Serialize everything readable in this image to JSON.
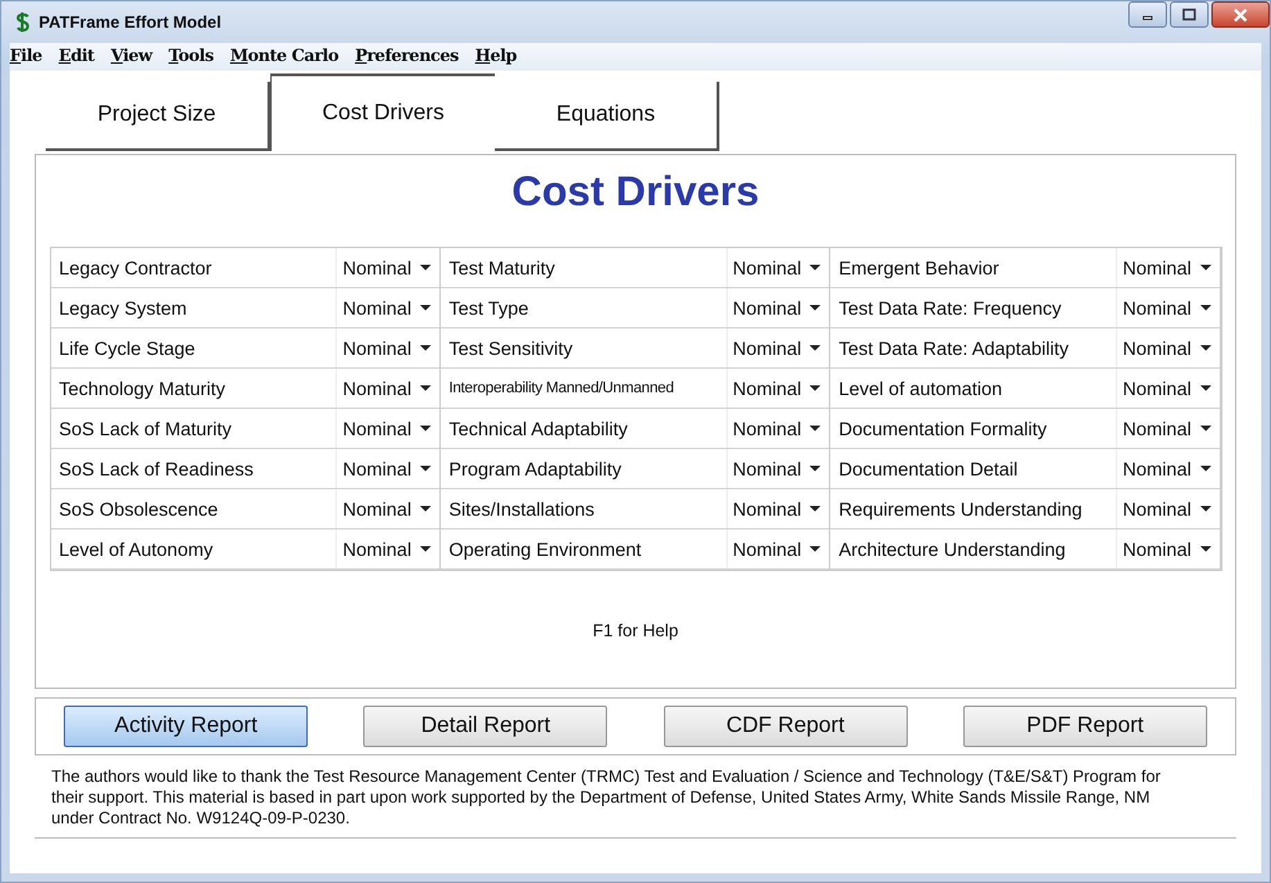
{
  "window": {
    "title": "PATFrame Effort Model"
  },
  "menu": [
    "File",
    "Edit",
    "View",
    "Tools",
    "Monte Carlo",
    "Preferences",
    "Help"
  ],
  "tabs": [
    {
      "label": "Project Size",
      "selected": false
    },
    {
      "label": "Cost Drivers",
      "selected": true
    },
    {
      "label": "Equations",
      "selected": false
    }
  ],
  "panel": {
    "heading": "Cost Drivers",
    "help": "F1 for Help"
  },
  "drivers": [
    [
      {
        "name": "Legacy Contractor",
        "value": "Nominal"
      },
      {
        "name": "Legacy System",
        "value": "Nominal"
      },
      {
        "name": "Life Cycle Stage",
        "value": "Nominal"
      },
      {
        "name": "Technology Maturity",
        "value": "Nominal"
      },
      {
        "name": "SoS Lack of Maturity",
        "value": "Nominal"
      },
      {
        "name": "SoS Lack of Readiness",
        "value": "Nominal"
      },
      {
        "name": "SoS Obsolescence",
        "value": "Nominal"
      },
      {
        "name": "Level of Autonomy",
        "value": "Nominal"
      }
    ],
    [
      {
        "name": "Test Maturity",
        "value": "Nominal"
      },
      {
        "name": "Test Type",
        "value": "Nominal"
      },
      {
        "name": "Test Sensitivity",
        "value": "Nominal"
      },
      {
        "name": "Interoperability Manned/Unmanned",
        "value": "Nominal"
      },
      {
        "name": "Technical Adaptability",
        "value": "Nominal"
      },
      {
        "name": "Program Adaptability",
        "value": "Nominal"
      },
      {
        "name": "Sites/Installations",
        "value": "Nominal"
      },
      {
        "name": "Operating Environment",
        "value": "Nominal"
      }
    ],
    [
      {
        "name": "Emergent Behavior",
        "value": "Nominal"
      },
      {
        "name": "Test Data Rate: Frequency",
        "value": "Nominal"
      },
      {
        "name": "Test Data Rate: Adaptability",
        "value": "Nominal"
      },
      {
        "name": "Level of automation",
        "value": "Nominal"
      },
      {
        "name": "Documentation Formality",
        "value": "Nominal"
      },
      {
        "name": "Documentation Detail",
        "value": "Nominal"
      },
      {
        "name": "Requirements Understanding",
        "value": "Nominal"
      },
      {
        "name": "Architecture Understanding",
        "value": "Nominal"
      }
    ]
  ],
  "buttons": [
    {
      "label": "Activity Report",
      "focused": true
    },
    {
      "label": "Detail Report",
      "focused": false
    },
    {
      "label": "CDF Report",
      "focused": false
    },
    {
      "label": "PDF Report",
      "focused": false
    }
  ],
  "acknowledgement": "The authors would like to thank the Test Resource Management Center (TRMC) Test and Evaluation / Science and Technology (T&E/S&T) Program for their support. This material is based in part upon work supported by the Department of Defense, United States Army, White Sands Missile Range, NM under Contract No. W9124Q-09-P-0230."
}
